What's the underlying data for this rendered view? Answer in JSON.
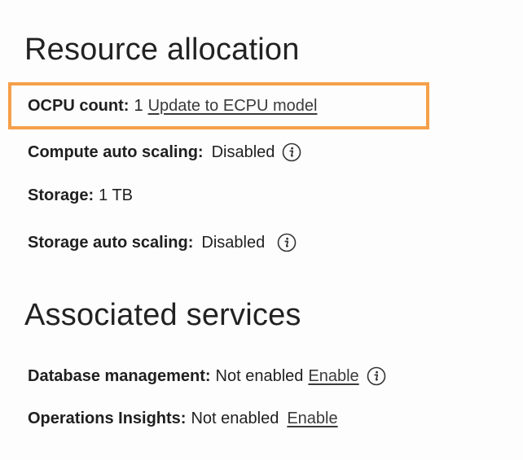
{
  "resource_allocation": {
    "title": "Resource allocation",
    "ocpu": {
      "label": "OCPU count:",
      "value": "1",
      "link": "Update to ECPU model"
    },
    "compute_auto_scaling": {
      "label": "Compute auto scaling:",
      "value": "Disabled",
      "icon": "info-icon"
    },
    "storage": {
      "label": "Storage:",
      "value": "1 TB"
    },
    "storage_auto_scaling": {
      "label": "Storage auto scaling:",
      "value": "Disabled",
      "icon": "info-icon"
    }
  },
  "associated_services": {
    "title": "Associated services",
    "database_management": {
      "label": "Database management:",
      "value": "Not enabled",
      "link": "Enable",
      "icon": "info-icon"
    },
    "operations_insights": {
      "label": "Operations Insights:",
      "value": "Not enabled",
      "link": "Enable"
    }
  },
  "colors": {
    "highlight": "#f5a04a",
    "text": "#222222"
  }
}
